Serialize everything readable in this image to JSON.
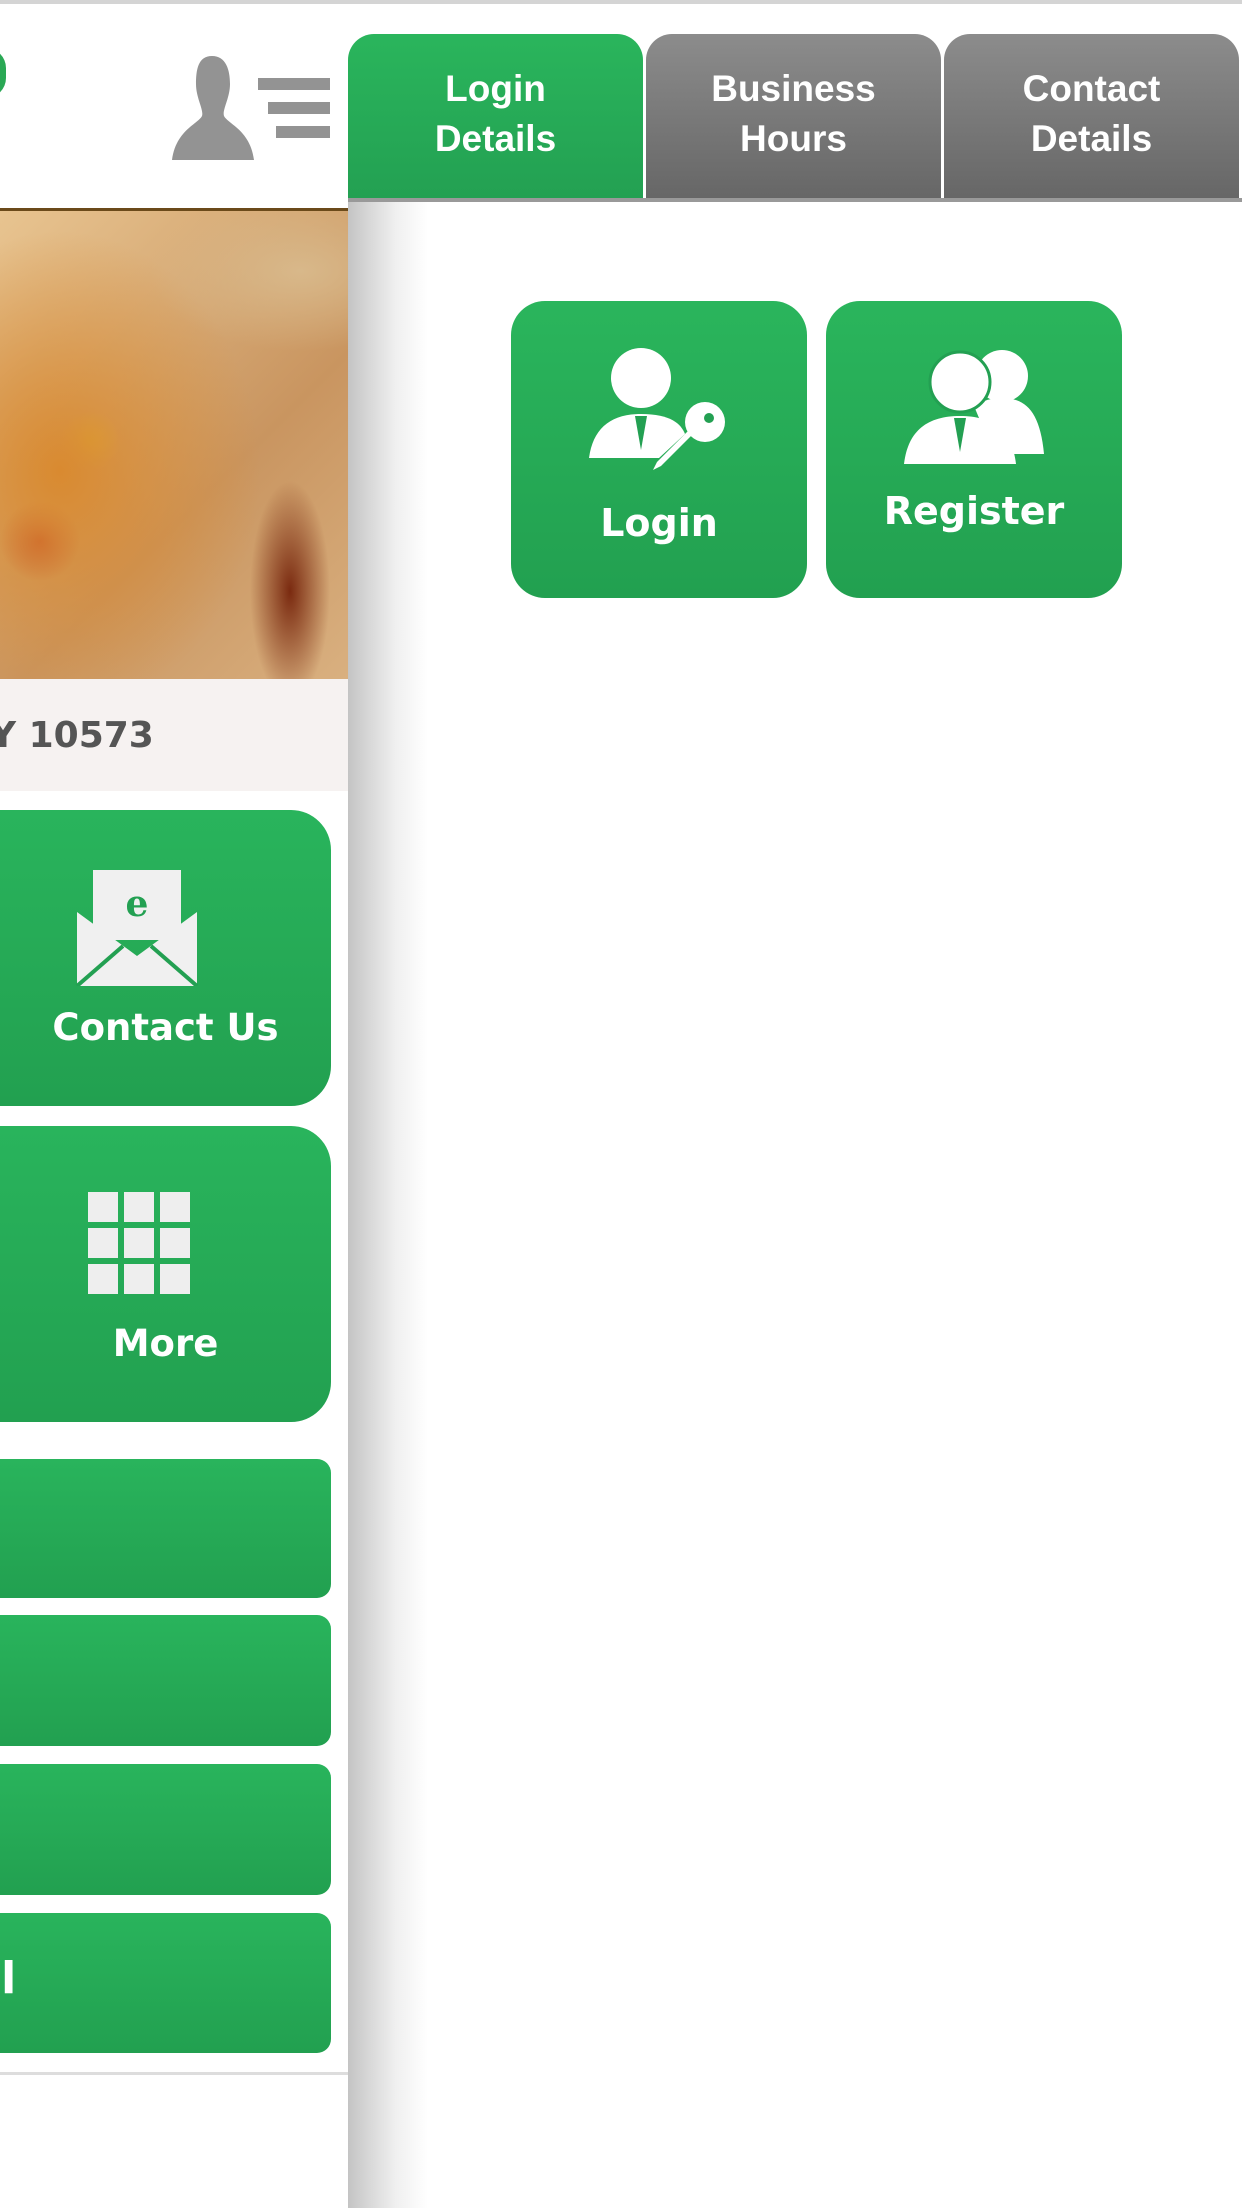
{
  "left_panel": {
    "address_fragment": "Y 10573",
    "buttons": [
      {
        "label": "Contact Us",
        "icon": "email-envelope-icon"
      },
      {
        "label": "More",
        "icon": "grid-icon"
      }
    ],
    "bars": [
      {
        "label": ""
      },
      {
        "label": ""
      },
      {
        "label": ""
      },
      {
        "label": "il"
      }
    ]
  },
  "tabs": [
    {
      "line1": "Login",
      "line2": "Details",
      "active": true
    },
    {
      "line1": "Business",
      "line2": "Hours",
      "active": false
    },
    {
      "line1": "Contact",
      "line2": "Details",
      "active": false
    }
  ],
  "actions": {
    "login": {
      "label": "Login",
      "icon": "user-key-icon"
    },
    "register": {
      "label": "Register",
      "icon": "users-icon"
    }
  },
  "colors": {
    "accent": "#27ae5a",
    "tab_inactive": "#777777"
  }
}
